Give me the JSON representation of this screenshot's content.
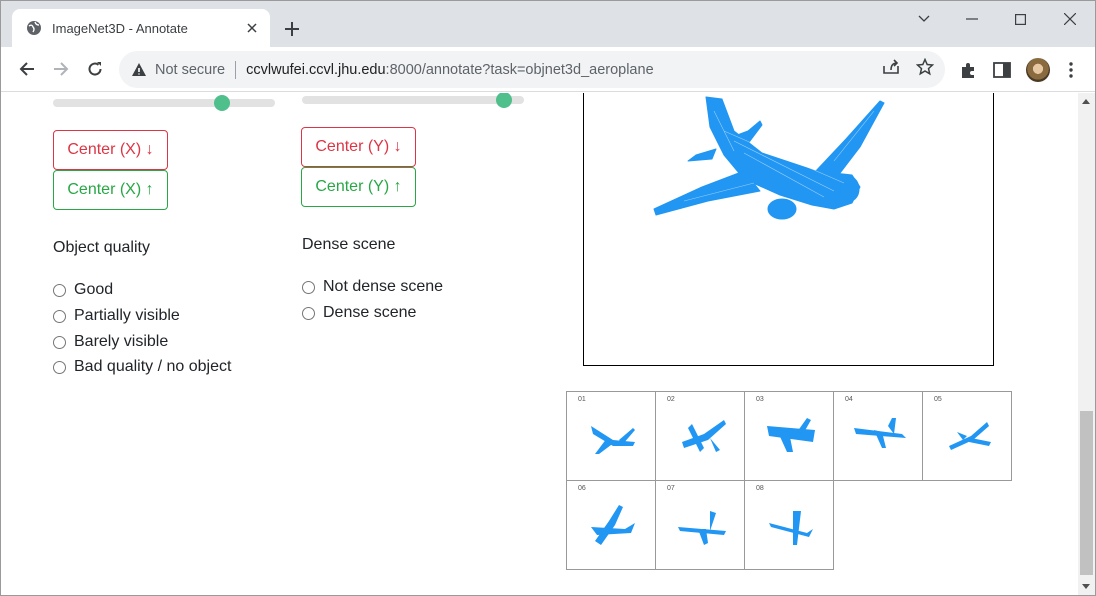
{
  "browser": {
    "tab_title": "ImageNet3D - Annotate",
    "security_label": "Not secure",
    "url_host": "ccvlwufei.ccvl.jhu.edu",
    "url_rest": ":8000/annotate?task=objnet3d_aeroplane"
  },
  "controls": {
    "slider_left_value": 0.78,
    "slider_mid_value": 0.94,
    "center_x_down": "Center (X) ↓",
    "center_x_up": "Center (X) ↑",
    "center_y_down": "Center (Y) ↓",
    "center_y_up": "Center (Y) ↑"
  },
  "object_quality": {
    "heading": "Object quality",
    "options": [
      "Good",
      "Partially visible",
      "Barely visible",
      "Bad quality / no object"
    ]
  },
  "dense_scene": {
    "heading": "Dense scene",
    "options": [
      "Not dense scene",
      "Dense scene"
    ]
  },
  "thumbnails": [
    "01",
    "02",
    "03",
    "04",
    "05",
    "06",
    "07",
    "08"
  ],
  "colors": {
    "accent_red": "#dc3545",
    "accent_green": "#28a745",
    "slider_thumb": "#4fbf8b",
    "model_blue": "#2196f3"
  }
}
